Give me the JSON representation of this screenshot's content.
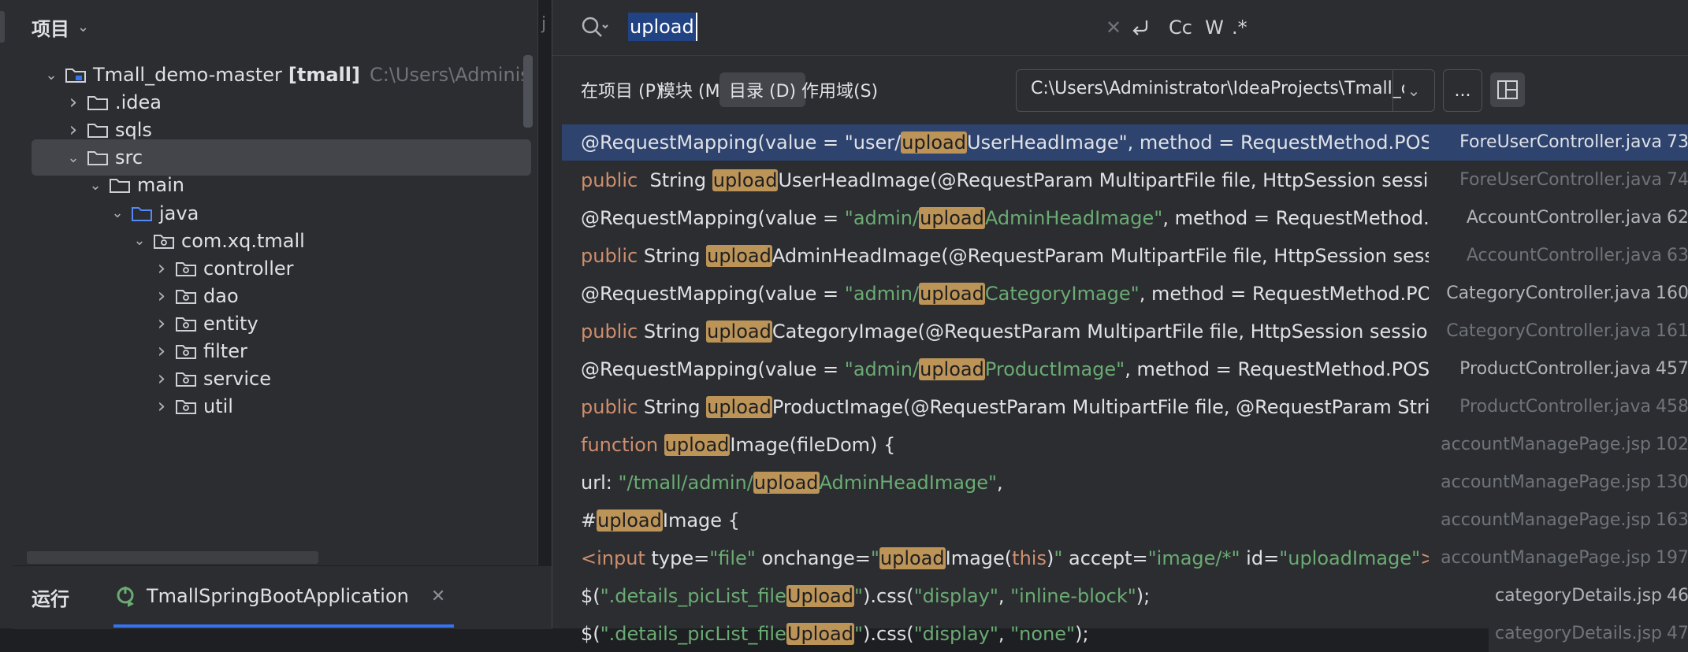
{
  "project_panel": {
    "title": "项目",
    "tree": [
      {
        "indent": 0,
        "arrow": "down",
        "name": "Tmall_demo-master",
        "module": "[tmall]",
        "path": "C:\\Users\\Administrat",
        "icon": "module-folder"
      },
      {
        "indent": 1,
        "arrow": "right",
        "name": ".idea",
        "icon": "folder"
      },
      {
        "indent": 1,
        "arrow": "right",
        "name": "sqls",
        "icon": "folder"
      },
      {
        "indent": 1,
        "arrow": "down",
        "name": "src",
        "icon": "folder",
        "selected": true
      },
      {
        "indent": 2,
        "arrow": "down",
        "name": "main",
        "icon": "folder"
      },
      {
        "indent": 3,
        "arrow": "down",
        "name": "java",
        "icon": "source-folder"
      },
      {
        "indent": 4,
        "arrow": "down",
        "name": "com.xq.tmall",
        "icon": "package"
      },
      {
        "indent": 5,
        "arrow": "right",
        "name": "controller",
        "icon": "package"
      },
      {
        "indent": 5,
        "arrow": "right",
        "name": "dao",
        "icon": "package"
      },
      {
        "indent": 5,
        "arrow": "right",
        "name": "entity",
        "icon": "package"
      },
      {
        "indent": 5,
        "arrow": "right",
        "name": "filter",
        "icon": "package"
      },
      {
        "indent": 5,
        "arrow": "right",
        "name": "service",
        "icon": "package"
      },
      {
        "indent": 5,
        "arrow": "right",
        "name": "util",
        "icon": "package"
      }
    ]
  },
  "editor_sliver": {
    "tab_char": "j"
  },
  "run_bar": {
    "title": "运行",
    "tab_label": "TmallSpringBootApplication",
    "tab_icon": "spring-boot-run-icon"
  },
  "find": {
    "query": "upload",
    "options": {
      "case": "Cc",
      "words": "W",
      "regex": ".*"
    },
    "scopes": [
      "在项目 (P)",
      "模块 (M)",
      "目录 (D)",
      "作用域(S)"
    ],
    "active_scope": 2,
    "directory": "C:\\Users\\Administrator\\IdeaProjects\\Tmall_demo-maste",
    "more_label": "...",
    "results": [
      {
        "file": "ForeUserController.java",
        "line": "73",
        "selected": true,
        "segments": [
          [
            "t",
            "@RequestMapping(value = \"user/"
          ],
          [
            "h",
            "upload"
          ],
          [
            "t",
            "UserHeadImage\", method = RequestMethod.POST, pro"
          ]
        ]
      },
      {
        "file": "ForeUserController.java",
        "line": "74",
        "segments": [
          [
            "k",
            "public"
          ],
          [
            "t",
            "  String "
          ],
          [
            "h",
            "upload"
          ],
          [
            "t",
            "UserHeadImage(@RequestParam MultipartFile file, HttpSession session"
          ]
        ]
      },
      {
        "file": "AccountController.java",
        "line": "62",
        "strong": true,
        "segments": [
          [
            "t",
            "@RequestMapping(value = "
          ],
          [
            "s",
            "\"admin/"
          ],
          [
            "h",
            "upload"
          ],
          [
            "s",
            "AdminHeadImage\""
          ],
          [
            "t",
            ", method = RequestMethod.POST,"
          ]
        ]
      },
      {
        "file": "AccountController.java",
        "line": "63",
        "segments": [
          [
            "k",
            "public"
          ],
          [
            "t",
            " String "
          ],
          [
            "h",
            "upload"
          ],
          [
            "t",
            "AdminHeadImage(@RequestParam MultipartFile file, HttpSession session) {"
          ]
        ]
      },
      {
        "file": "CategoryController.java",
        "line": "160",
        "strong": true,
        "segments": [
          [
            "t",
            "@RequestMapping(value = "
          ],
          [
            "s",
            "\"admin/"
          ],
          [
            "h",
            "upload"
          ],
          [
            "s",
            "CategoryImage\""
          ],
          [
            "t",
            ", method = RequestMethod.POST,"
          ]
        ]
      },
      {
        "file": "CategoryController.java",
        "line": "161",
        "segments": [
          [
            "k",
            "public"
          ],
          [
            "t",
            " String "
          ],
          [
            "h",
            "upload"
          ],
          [
            "t",
            "CategoryImage(@RequestParam MultipartFile file, HttpSession session) {"
          ]
        ]
      },
      {
        "file": "ProductController.java",
        "line": "457",
        "strong": true,
        "segments": [
          [
            "t",
            "@RequestMapping(value = "
          ],
          [
            "s",
            "\"admin/"
          ],
          [
            "h",
            "upload"
          ],
          [
            "s",
            "ProductImage\""
          ],
          [
            "t",
            ", method = RequestMethod.POST, pro"
          ]
        ]
      },
      {
        "file": "ProductController.java",
        "line": "458",
        "segments": [
          [
            "k",
            "public"
          ],
          [
            "t",
            " String "
          ],
          [
            "h",
            "upload"
          ],
          [
            "t",
            "ProductImage(@RequestParam MultipartFile file, @RequestParam String ima"
          ]
        ]
      },
      {
        "file": "accountManagePage.jsp",
        "line": "102",
        "segments": [
          [
            "k",
            "function "
          ],
          [
            "h",
            "upload"
          ],
          [
            "t",
            "Image(fileDom) {"
          ]
        ]
      },
      {
        "file": "accountManagePage.jsp",
        "line": "130",
        "segments": [
          [
            "t",
            "url: "
          ],
          [
            "s",
            "\"/tmall/admin/"
          ],
          [
            "h",
            "upload"
          ],
          [
            "s",
            "AdminHeadImage\""
          ],
          [
            "t",
            ","
          ]
        ]
      },
      {
        "file": "accountManagePage.jsp",
        "line": "163",
        "segments": [
          [
            "t",
            "#"
          ],
          [
            "h",
            "upload"
          ],
          [
            "t",
            "Image {"
          ]
        ]
      },
      {
        "file": "accountManagePage.jsp",
        "line": "197",
        "segments": [
          [
            "g",
            "<input "
          ],
          [
            "t",
            "type="
          ],
          [
            "s",
            "\"file\""
          ],
          [
            "t",
            " onchange="
          ],
          [
            "s",
            "\""
          ],
          [
            "h",
            "upload"
          ],
          [
            "t",
            "Image("
          ],
          [
            "k",
            "this"
          ],
          [
            "t",
            ")"
          ],
          [
            "s",
            "\""
          ],
          [
            "t",
            " accept="
          ],
          [
            "s",
            "\"image/*\""
          ],
          [
            "t",
            " id="
          ],
          [
            "s",
            "\"uploadImage\""
          ],
          [
            "g",
            ">"
          ]
        ]
      },
      {
        "file": "categoryDetails.jsp",
        "line": "46",
        "strong": true,
        "segments": [
          [
            "t",
            "$("
          ],
          [
            "s",
            "\".details_picList_file"
          ],
          [
            "h",
            "Upload"
          ],
          [
            "s",
            "\""
          ],
          [
            "t",
            ").css("
          ],
          [
            "s",
            "\"display\""
          ],
          [
            "t",
            ", "
          ],
          [
            "s",
            "\"inline-block\""
          ],
          [
            "t",
            ");"
          ]
        ]
      },
      {
        "file": "categoryDetails.jsp",
        "line": "47",
        "segments": [
          [
            "t",
            "$("
          ],
          [
            "s",
            "\".details_picList_file"
          ],
          [
            "h",
            "Upload"
          ],
          [
            "s",
            "\""
          ],
          [
            "t",
            ").css("
          ],
          [
            "s",
            "\"display\""
          ],
          [
            "t",
            ", "
          ],
          [
            "s",
            "\"none\""
          ],
          [
            "t",
            ");"
          ]
        ]
      }
    ]
  },
  "colors": {
    "highlight": "#bc9458",
    "selection": "#2e436e",
    "keyword": "#cf8e6d",
    "string": "#6aab73",
    "accent": "#3574f0"
  }
}
